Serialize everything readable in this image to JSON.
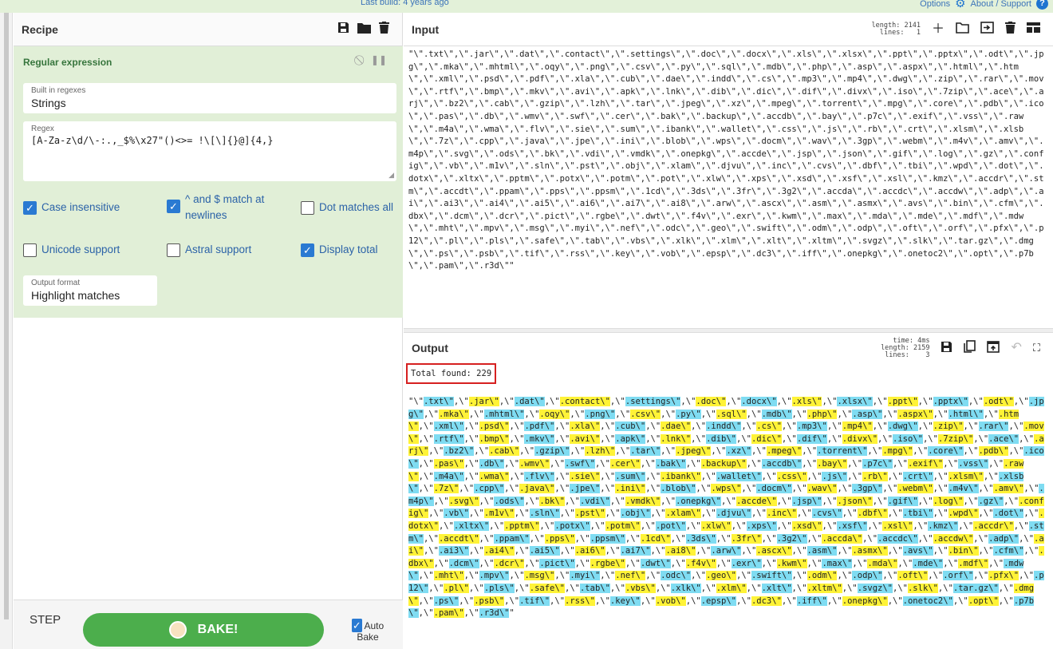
{
  "topbar": {
    "last_build": "Last build: 4 years ago",
    "options": "Options",
    "about": "About / Support"
  },
  "recipe": {
    "title": "Recipe",
    "operation": "Regular expression",
    "builtin_label": "Built in regexes",
    "builtin_value": "Strings",
    "regex_label": "Regex",
    "regex_value": "[A-Za-z\\d/\\-:.,_$%\\x27\"()<>= !\\[\\]{}@]{4,}",
    "case_insensitive": "Case insensitive",
    "multiline": "^ and $ match at newlines",
    "dot_all": "Dot matches all",
    "unicode": "Unicode support",
    "astral": "Astral support",
    "display_total": "Display total",
    "output_format_label": "Output format",
    "output_format_value": "Highlight matches"
  },
  "controls": {
    "step": "STEP",
    "bake": "BAKE!",
    "auto_bake": "Auto Bake"
  },
  "input": {
    "title": "Input",
    "stats": "length: 2141\nlines:   1"
  },
  "output": {
    "title": "Output",
    "stats": "time: 4ms\nlength: 2159\nlines:    3",
    "total": "Total found: 229"
  },
  "extensions": [
    ".txt",
    ".jar",
    ".dat",
    ".contact",
    ".settings",
    ".doc",
    ".docx",
    ".xls",
    ".xlsx",
    ".ppt",
    ".pptx",
    ".odt",
    ".jpg",
    ".mka",
    ".mhtml",
    ".oqy",
    ".png",
    ".csv",
    ".py",
    ".sql",
    ".mdb",
    ".php",
    ".asp",
    ".aspx",
    ".html",
    ".htm",
    ".xml",
    ".psd",
    ".pdf",
    ".xla",
    ".cub",
    ".dae",
    ".indd",
    ".cs",
    ".mp3",
    ".mp4",
    ".dwg",
    ".zip",
    ".rar",
    ".mov",
    ".rtf",
    ".bmp",
    ".mkv",
    ".avi",
    ".apk",
    ".lnk",
    ".dib",
    ".dic",
    ".dif",
    ".divx",
    ".iso",
    ".7zip",
    ".ace",
    ".arj",
    ".bz2",
    ".cab",
    ".gzip",
    ".lzh",
    ".tar",
    ".jpeg",
    ".xz",
    ".mpeg",
    ".torrent",
    ".mpg",
    ".core",
    ".pdb",
    ".ico",
    ".pas",
    ".db",
    ".wmv",
    ".swf",
    ".cer",
    ".bak",
    ".backup",
    ".accdb",
    ".bay",
    ".p7c",
    ".exif",
    ".vss",
    ".raw",
    ".m4a",
    ".wma",
    ".flv",
    ".sie",
    ".sum",
    ".ibank",
    ".wallet",
    ".css",
    ".js",
    ".rb",
    ".crt",
    ".xlsm",
    ".xlsb",
    ".7z",
    ".cpp",
    ".java",
    ".jpe",
    ".ini",
    ".blob",
    ".wps",
    ".docm",
    ".wav",
    ".3gp",
    ".webm",
    ".m4v",
    ".amv",
    ".m4p",
    ".svg",
    ".ods",
    ".bk",
    ".vdi",
    ".vmdk",
    ".onepkg",
    ".accde",
    ".jsp",
    ".json",
    ".gif",
    ".log",
    ".gz",
    ".config",
    ".vb",
    ".m1v",
    ".sln",
    ".pst",
    ".obj",
    ".xlam",
    ".djvu",
    ".inc",
    ".cvs",
    ".dbf",
    ".tbi",
    ".wpd",
    ".dot",
    ".dotx",
    ".xltx",
    ".pptm",
    ".potx",
    ".potm",
    ".pot",
    ".xlw",
    ".xps",
    ".xsd",
    ".xsf",
    ".xsl",
    ".kmz",
    ".accdr",
    ".stm",
    ".accdt",
    ".ppam",
    ".pps",
    ".ppsm",
    ".1cd",
    ".3ds",
    ".3fr",
    ".3g2",
    ".accda",
    ".accdc",
    ".accdw",
    ".adp",
    ".ai",
    ".ai3",
    ".ai4",
    ".ai5",
    ".ai6",
    ".ai7",
    ".ai8",
    ".arw",
    ".ascx",
    ".asm",
    ".asmx",
    ".avs",
    ".bin",
    ".cfm",
    ".dbx",
    ".dcm",
    ".dcr",
    ".pict",
    ".rgbe",
    ".dwt",
    ".f4v",
    ".exr",
    ".kwm",
    ".max",
    ".mda",
    ".mde",
    ".mdf",
    ".mdw",
    ".mht",
    ".mpv",
    ".msg",
    ".myi",
    ".nef",
    ".odc",
    ".geo",
    ".swift",
    ".odm",
    ".odp",
    ".oft",
    ".orf",
    ".pfx",
    ".p12",
    ".pl",
    ".pls",
    ".safe",
    ".tab",
    ".vbs",
    ".xlk",
    ".xlm",
    ".xlt",
    ".xltm",
    ".svgz",
    ".slk",
    ".tar.gz",
    ".dmg",
    ".ps",
    ".psb",
    ".tif",
    ".rss",
    ".key",
    ".vob",
    ".epsp",
    ".dc3",
    ".iff",
    ".onepkg",
    ".onetoc2",
    ".opt",
    ".p7b",
    ".pam",
    ".r3d"
  ],
  "colors": {
    "highlight_a": "#7fdcf2",
    "highlight_b": "#fff337",
    "recipe_bg": "#e1efd7",
    "bake": "#4cae4c"
  }
}
